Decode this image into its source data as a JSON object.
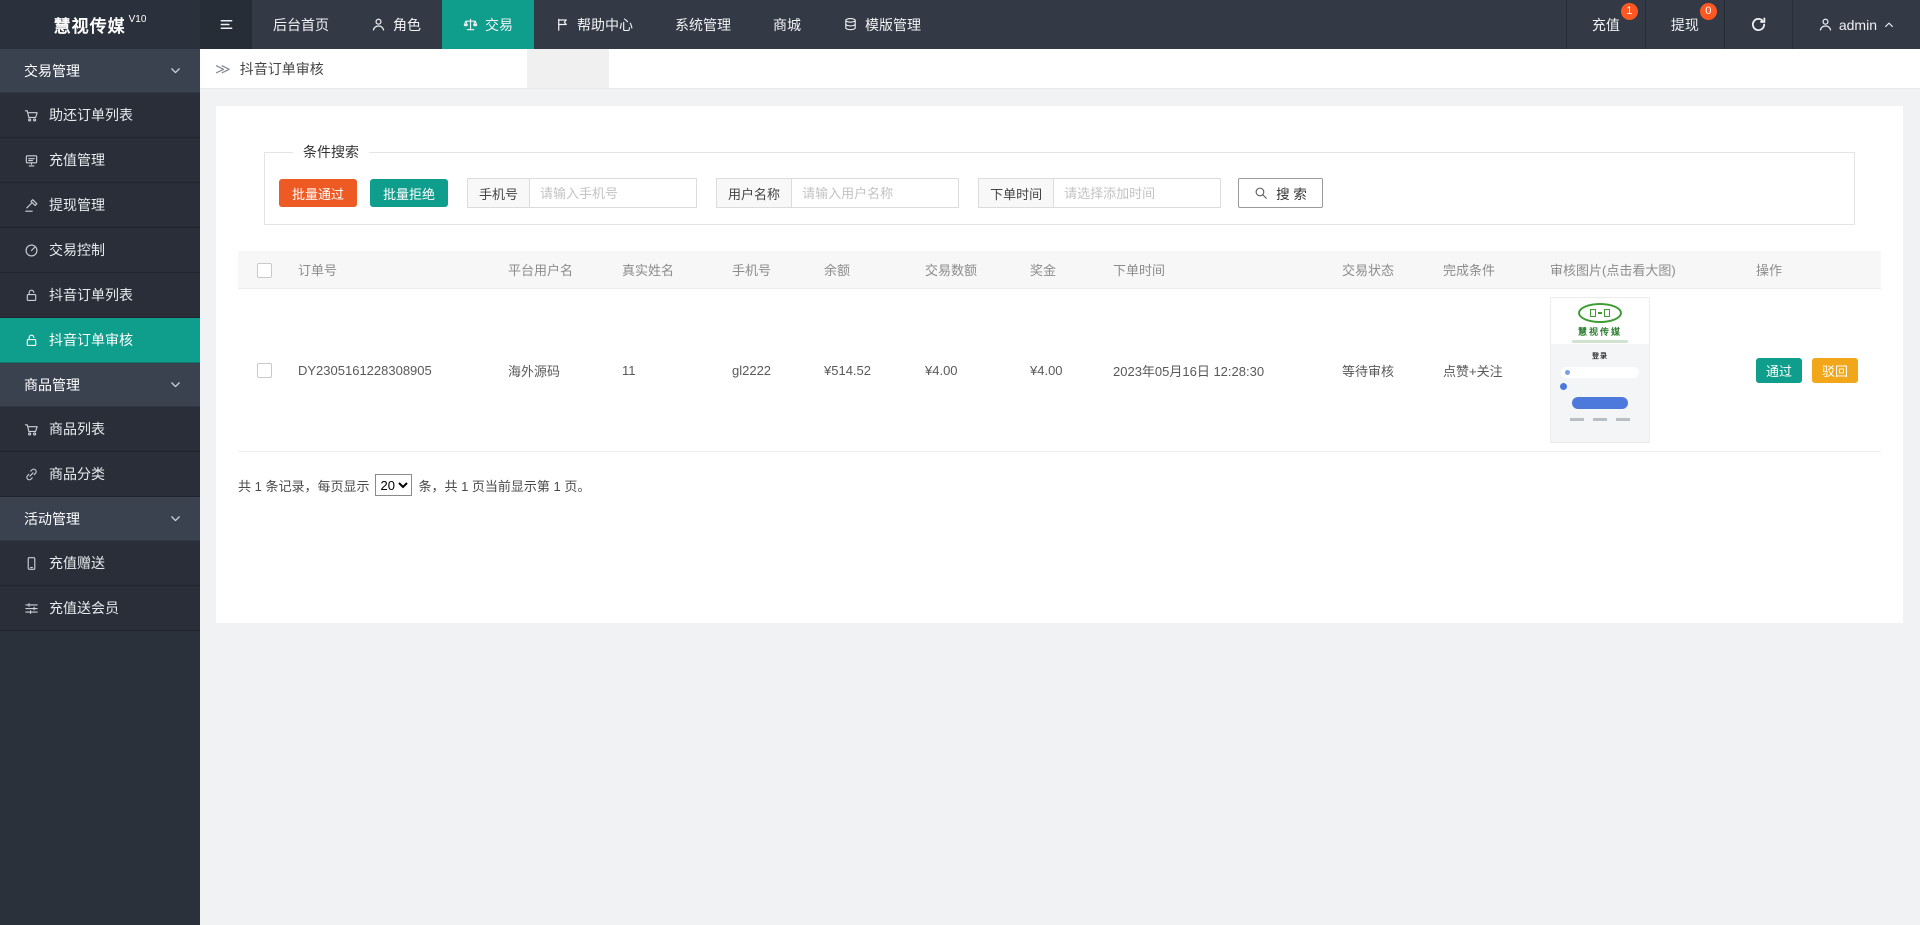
{
  "navbar": {
    "brand": "慧视传媒",
    "version": "V10",
    "items": [
      {
        "label": "后台首页"
      },
      {
        "label": "角色"
      },
      {
        "label": "交易",
        "active": true
      },
      {
        "label": "帮助中心"
      },
      {
        "label": "系统管理"
      },
      {
        "label": "商城"
      },
      {
        "label": "模版管理"
      }
    ],
    "recharge_label": "充值",
    "recharge_badge": "1",
    "withdraw_label": "提现",
    "withdraw_badge": "0",
    "username": "admin"
  },
  "sidebar": {
    "groups": [
      {
        "label": "交易管理",
        "items": [
          {
            "label": "助还订单列表"
          },
          {
            "label": "充值管理"
          },
          {
            "label": "提现管理"
          },
          {
            "label": "交易控制"
          },
          {
            "label": "抖音订单列表"
          },
          {
            "label": "抖音订单审核",
            "active": true
          }
        ]
      },
      {
        "label": "商品管理",
        "items": [
          {
            "label": "商品列表"
          },
          {
            "label": "商品分类"
          }
        ]
      },
      {
        "label": "活动管理",
        "items": [
          {
            "label": "充值赠送"
          },
          {
            "label": "充值送会员"
          }
        ]
      }
    ]
  },
  "breadcrumb": {
    "icon": "≫",
    "title": "抖音订单审核"
  },
  "search": {
    "legend": "条件搜索",
    "batch_approve": "批量通过",
    "batch_reject": "批量拒绝",
    "phone_label": "手机号",
    "phone_placeholder": "请输入手机号",
    "user_label": "用户名称",
    "user_placeholder": "请输入用户名称",
    "time_label": "下单时间",
    "time_placeholder": "请选择添加时间",
    "search_label": "搜 索"
  },
  "table": {
    "columns": [
      "订单号",
      "平台用户名",
      "真实姓名",
      "手机号",
      "余额",
      "交易数额",
      "奖金",
      "下单时间",
      "交易状态",
      "完成条件",
      "审核图片(点击看大图)",
      "操作"
    ],
    "row": {
      "order_no": "DY2305161228308905",
      "platform_user": "海外源码",
      "real_name": "11",
      "phone": "gl2222",
      "balance": "¥514.52",
      "amount": "¥4.00",
      "bonus": "¥4.00",
      "time": "2023年05月16日 12:28:30",
      "status": "等待审核",
      "condition": "点赞+关注",
      "approve_label": "通过",
      "reject_label": "驳回"
    },
    "review_image": {
      "brand": "慧视传媒",
      "login_title": "登录"
    }
  },
  "footer": {
    "prefix": "共 1 条记录，每页显示",
    "page_size": "20",
    "suffix": "条，共 1 页当前显示第 1 页。"
  },
  "colors": {
    "accent": "#0f9d8c",
    "orange": "#ee5a23",
    "amber": "#f2a71b",
    "badge": "#ff5722"
  }
}
